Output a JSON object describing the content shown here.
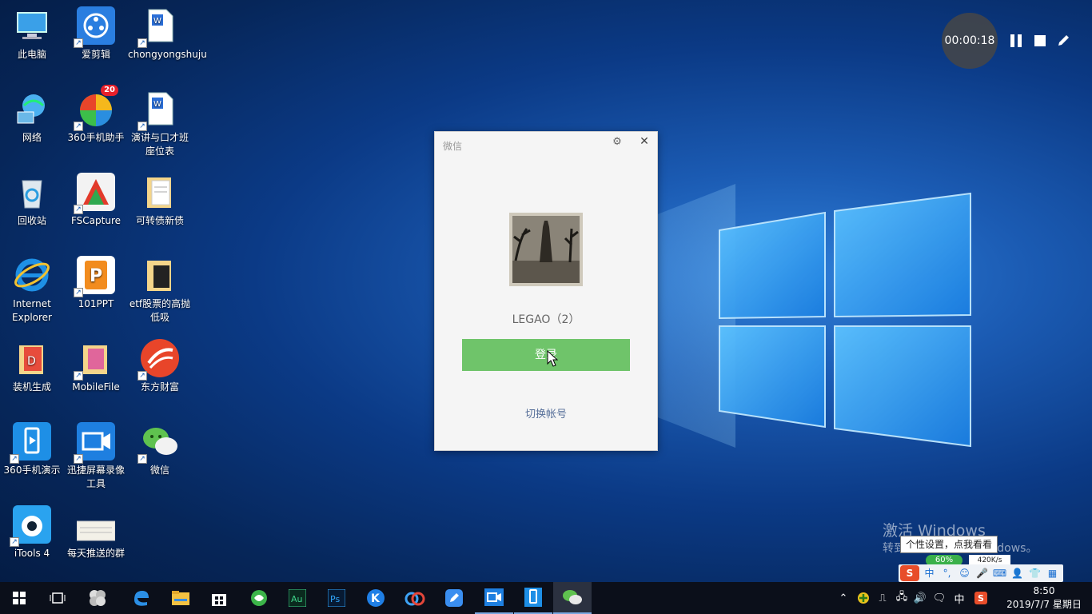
{
  "desktop": {
    "icons": [
      {
        "label": "此电脑"
      },
      {
        "label": "爱剪辑"
      },
      {
        "label": "chongyongshuju"
      },
      {
        "label": "网络"
      },
      {
        "label": "360手机助手",
        "badge": "20"
      },
      {
        "label": "演讲与口才班座位表"
      },
      {
        "label": "回收站"
      },
      {
        "label": "FSCapture"
      },
      {
        "label": "可转债新债"
      },
      {
        "label": "Internet Explorer"
      },
      {
        "label": "101PPT"
      },
      {
        "label": "etf股票的高抛低吸"
      },
      {
        "label": "装机生成"
      },
      {
        "label": "MobileFile"
      },
      {
        "label": "东方财富"
      },
      {
        "label": "360手机演示"
      },
      {
        "label": "迅捷屏幕录像工具"
      },
      {
        "label": "微信"
      },
      {
        "label": "iTools 4"
      },
      {
        "label": "每天推送的群"
      }
    ]
  },
  "recorder": {
    "time": "00:00:18"
  },
  "wechat": {
    "title": "微信",
    "account_name": "LEGAO（2）",
    "login_label": "登录",
    "switch_label": "切换帐号"
  },
  "watermark": {
    "line1": "激活 Windows",
    "line2": "转到“设置”以激活 Windows。"
  },
  "tooltip": {
    "text": "个性设置，点我看看"
  },
  "ime": {
    "mode": "中",
    "net_percent": "60%",
    "net_speed": "420K/s"
  },
  "taskbar": {
    "apps": [
      "start",
      "task-view",
      "pinwheel",
      "edge",
      "file-explorer",
      "store",
      "360-browser",
      "audition",
      "photoshop",
      "kuaibo",
      "baidu-netdisk",
      "notes",
      "screen-recorder",
      "360-mobile-demo",
      "wechat"
    ],
    "ime_label": "中",
    "time": "8:50",
    "date": "2019/7/7 星期日"
  },
  "colors": {
    "wechat_green": "#6fc46a",
    "taskbar": "#0b0f1a"
  }
}
